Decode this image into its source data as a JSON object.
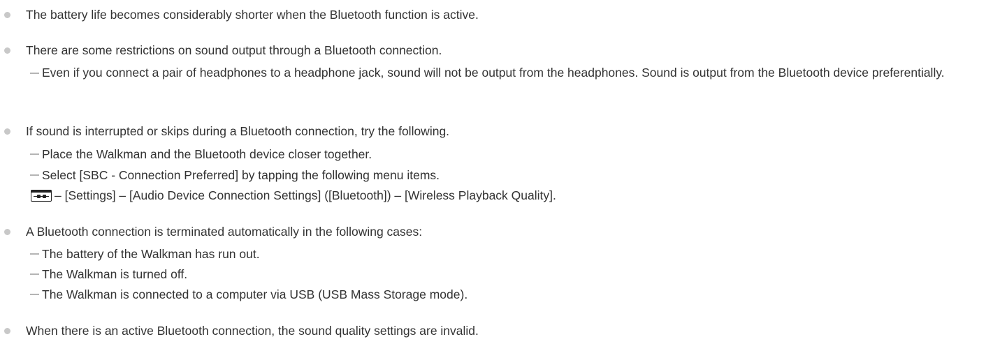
{
  "notes": [
    {
      "text": "The battery life becomes considerably shorter when the Bluetooth function is active.",
      "subitems": []
    },
    {
      "text": "There are some restrictions on sound output through a Bluetooth connection.",
      "subitems": [
        "Even if you connect a pair of headphones to a headphone jack, sound will not be output from the headphones. Sound is output from the Bluetooth device preferentially."
      ]
    },
    {
      "text": "If sound is interrupted or skips during a Bluetooth connection, try the following.",
      "subitems": [
        "Place the Walkman and the Bluetooth device closer together.",
        "Select [SBC - Connection Preferred] by tapping the following menu items."
      ],
      "menu_path": "– [Settings] – [Audio Device Connection Settings] ([Bluetooth]) – [Wireless Playback Quality].",
      "menu_icon": "options-menu-icon"
    },
    {
      "text": "A Bluetooth connection is terminated automatically in the following cases:",
      "subitems": [
        "The battery of the Walkman has run out.",
        "The Walkman is turned off.",
        "The Walkman is connected to a computer via USB (USB Mass Storage mode)."
      ]
    },
    {
      "text": "When there is an active Bluetooth connection, the sound quality settings are invalid.",
      "subitems": []
    }
  ],
  "colors": {
    "text": "#333333",
    "bullet": "#c8c8c8",
    "dash": "#b5b5b5"
  }
}
